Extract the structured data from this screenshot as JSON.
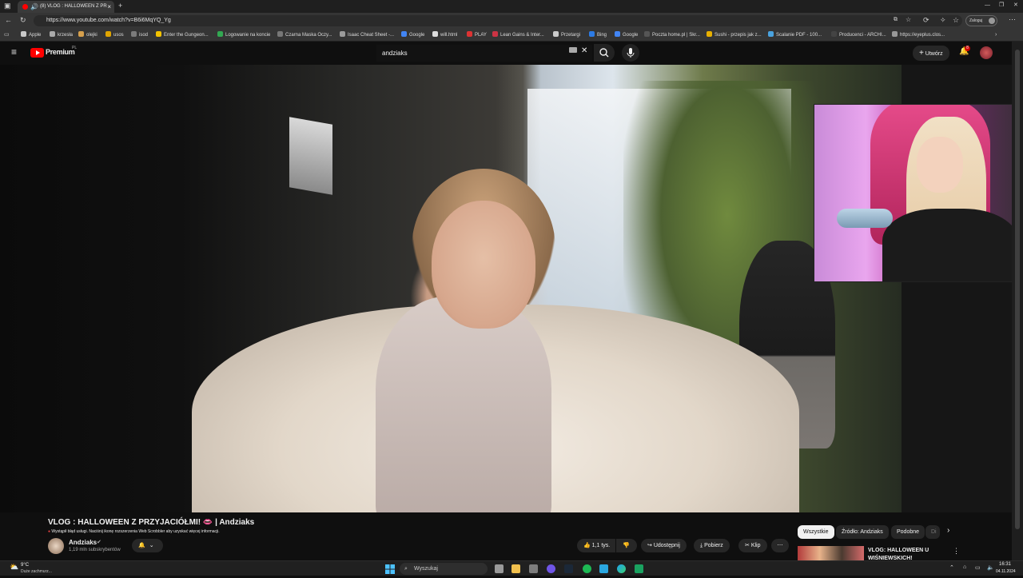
{
  "browser": {
    "tab": {
      "title": "(8) VLOG : HALLOWEEN Z PR",
      "close": "×"
    },
    "new_tab": "+",
    "url": "https://www.youtube.com/watch?v=B6i6MqYQ_Yg",
    "profile_label": "Zaloguj",
    "bookmarks": [
      "Apple",
      "krzesła",
      "olejki",
      "usos",
      "isod",
      "Enter the Gungeon...",
      "Logowanie na koncie",
      "Czarna Maska Oczy...",
      "Isaac Cheat Sheet -...",
      "Google",
      "will.html",
      "PLAY",
      "Lean Gains & Inter...",
      "Przetargi",
      "Bing",
      "Google",
      "Poczta home.pl | Skr...",
      "Sushi - przepis jak z...",
      "Scalanie PDF - 100...",
      "Producenci - ARCHI...",
      "https://eyeplus.clos..."
    ],
    "colors": {
      "tab_active": "#3a3a3a",
      "chrome_bg": "#1f1f1f"
    }
  },
  "youtube": {
    "logo_text": "Premium",
    "logo_superscript": "PL",
    "search_value": "andziaks",
    "create_label": "Utwórz",
    "notification_count": "8",
    "video": {
      "title": "VLOG : HALLOWEEN Z PRZYJACIÓŁMI! 👄 | Andziaks",
      "scrobbler_warning": "Wystąpił błąd usługi. Naciśnij ikonę rozszerzenia Web Scrobbler aby uzyskać więcej informacji.",
      "channel_name": "Andziaks",
      "subscribers": "1,19 mln subskrybentów",
      "likes": "1,1 tys.",
      "share_label": "Udostępnij",
      "download_label": "Pobierz",
      "clip_label": "Klip"
    },
    "chips": [
      "Wszystkie",
      "Źródło: Andziaks",
      "Podobne",
      "Di"
    ],
    "recommended": {
      "title": "VLOG: HALLOWEEN U WIŚNIEWSKICH!"
    },
    "accent": "#ff0000"
  },
  "taskbar": {
    "weather_temp": "9°C",
    "weather_desc": "Duże zachmurz...",
    "search_placeholder": "Wyszukaj",
    "time": "16:31",
    "date": "04.11.2024"
  }
}
